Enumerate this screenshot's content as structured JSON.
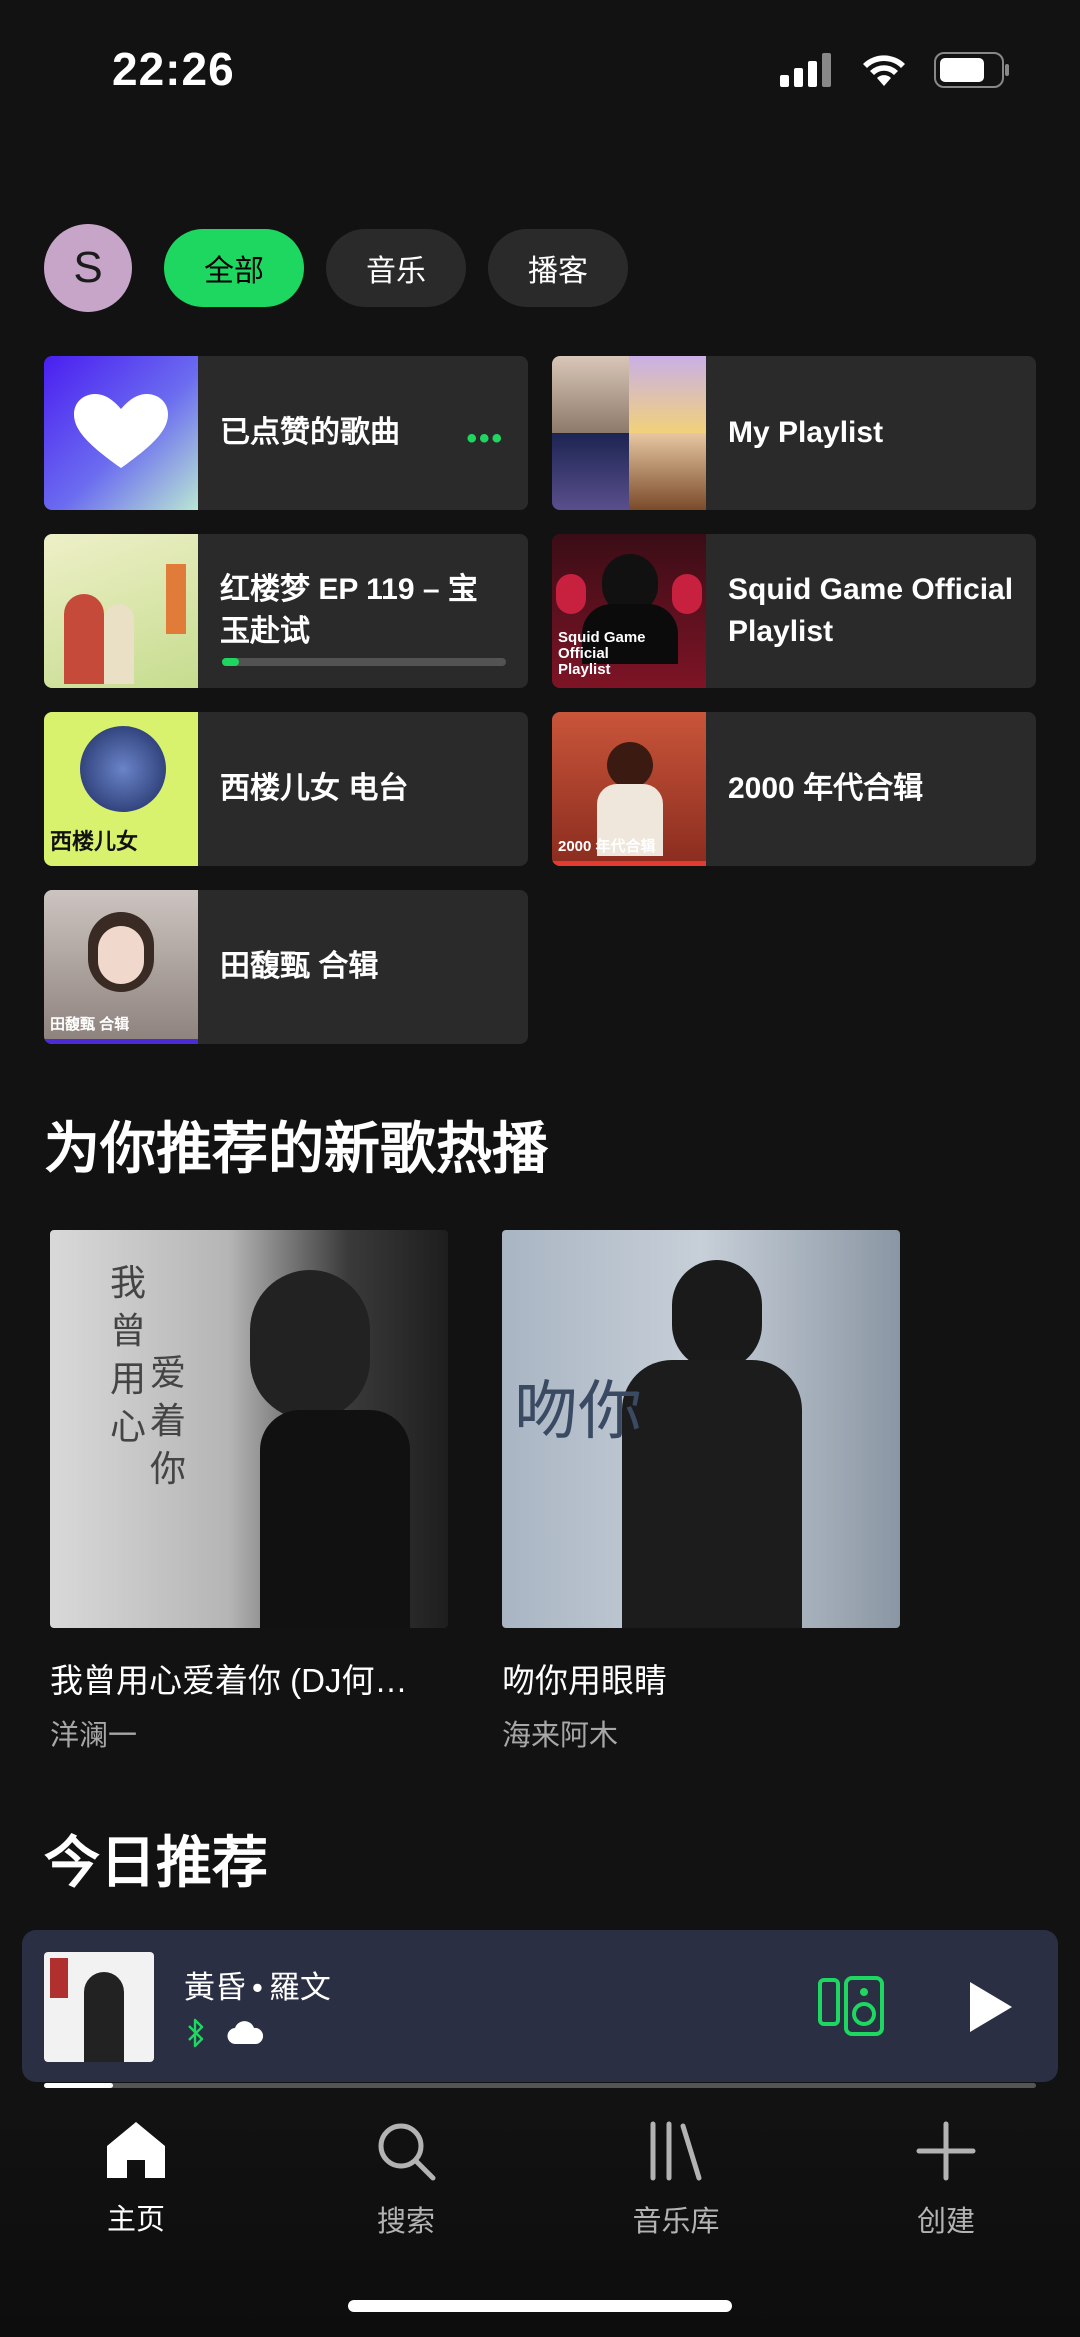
{
  "status": {
    "time": "22:26"
  },
  "filters": {
    "avatar_letter": "S",
    "chips": [
      "全部",
      "音乐",
      "播客"
    ]
  },
  "quick": [
    {
      "label": "已点赞的歌曲"
    },
    {
      "label": "My Playlist"
    },
    {
      "label": "红楼梦 EP 119 – 宝玉赴试",
      "progress": 0.06
    },
    {
      "label": "Squid Game Official Playlist"
    },
    {
      "label": "西楼儿女 电台"
    },
    {
      "label": "2000 年代合辑"
    },
    {
      "label": "田馥甄 合辑"
    }
  ],
  "thumbs": {
    "squid": "Squid Game Official Playlist",
    "xilou": "西楼儿女",
    "era2000": "2000 年代合辑",
    "tian": "田馥甄 合辑"
  },
  "sections": {
    "new_hits": "为你推荐的新歌热播",
    "today": "今日推荐"
  },
  "cards": [
    {
      "title": "我曾用心爱着你 (DJ何…",
      "artist": "洋澜一"
    },
    {
      "title": "吻你用眼睛",
      "artist": "海来阿木"
    }
  ],
  "player": {
    "song": "黃昏",
    "artist": "羅文",
    "progress": 0.07
  },
  "nav": [
    "主页",
    "搜索",
    "音乐库",
    "创建"
  ],
  "colors": {
    "accent": "#1ed760",
    "background": "#121212",
    "tile": "#2a2a2a",
    "player": "#2b2f43"
  }
}
